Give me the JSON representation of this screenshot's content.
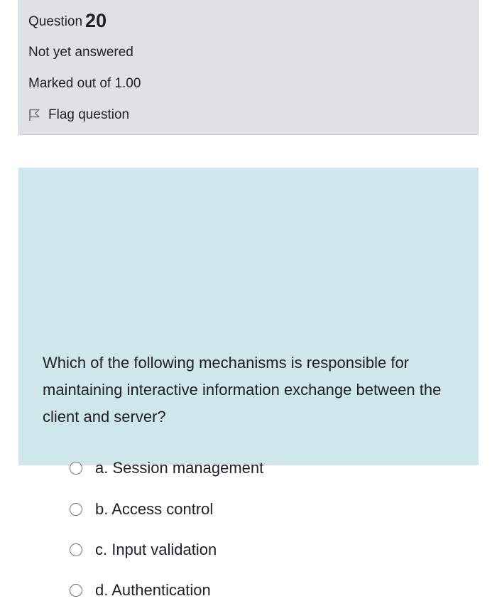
{
  "question_info": {
    "label": "Question",
    "number": "20",
    "state": "Not yet answered",
    "grade": "Marked out of 1.00",
    "flag_label": "Flag question"
  },
  "question": {
    "text": "Which of the following mechanisms is responsible for maintaining interactive information exchange between the client and server?",
    "answers": [
      {
        "label": "a. Session management",
        "selected": false
      },
      {
        "label": "b. Access control",
        "selected": false
      },
      {
        "label": "c. Input validation",
        "selected": false
      },
      {
        "label": "d. Authentication",
        "selected": false
      }
    ]
  },
  "colors": {
    "info_background": "#dee2e6",
    "content_background": "#cfe6ec",
    "text": "#1d2125"
  },
  "icons": {
    "flag": "flag-icon",
    "radio": "radio-button"
  }
}
